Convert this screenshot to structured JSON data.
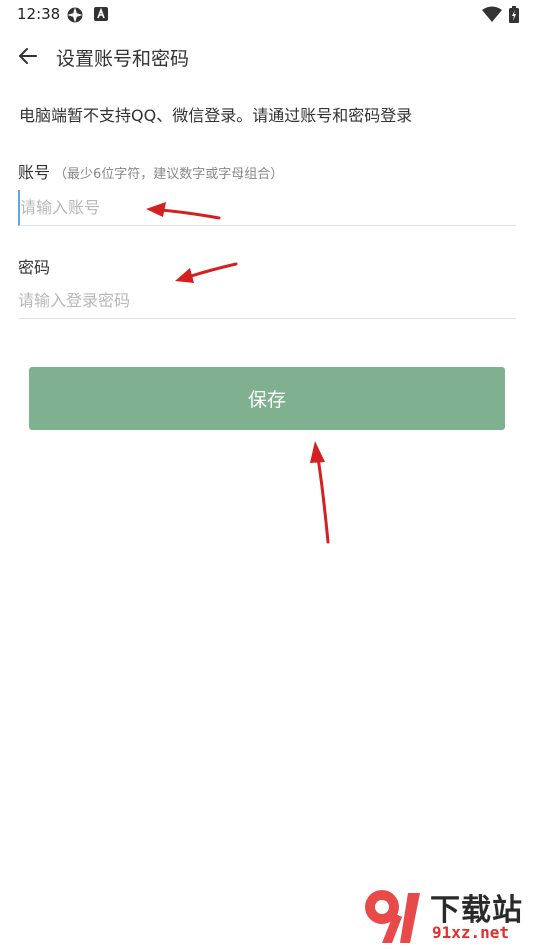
{
  "status_bar": {
    "time": "12:38",
    "icons": [
      "settings-icon",
      "a-badge-icon",
      "wifi-icon",
      "battery-icon"
    ]
  },
  "header": {
    "back_icon": "arrow-left-icon",
    "title": "设置账号和密码"
  },
  "notice": "电脑端暂不支持QQ、微信登录。请通过账号和密码登录",
  "account": {
    "label": "账号",
    "hint": "（最少6位字符，建议数字或字母组合）",
    "placeholder": "请输入账号",
    "value": ""
  },
  "password": {
    "label": "密码",
    "placeholder": "请输入登录密码",
    "value": ""
  },
  "save_button": "保存",
  "colors": {
    "button": "#7fb090",
    "annotation_arrow": "#d42020",
    "cursor": "#5ea6e6"
  },
  "watermark": {
    "title": "下载站",
    "subtitle": "91xz.net"
  }
}
